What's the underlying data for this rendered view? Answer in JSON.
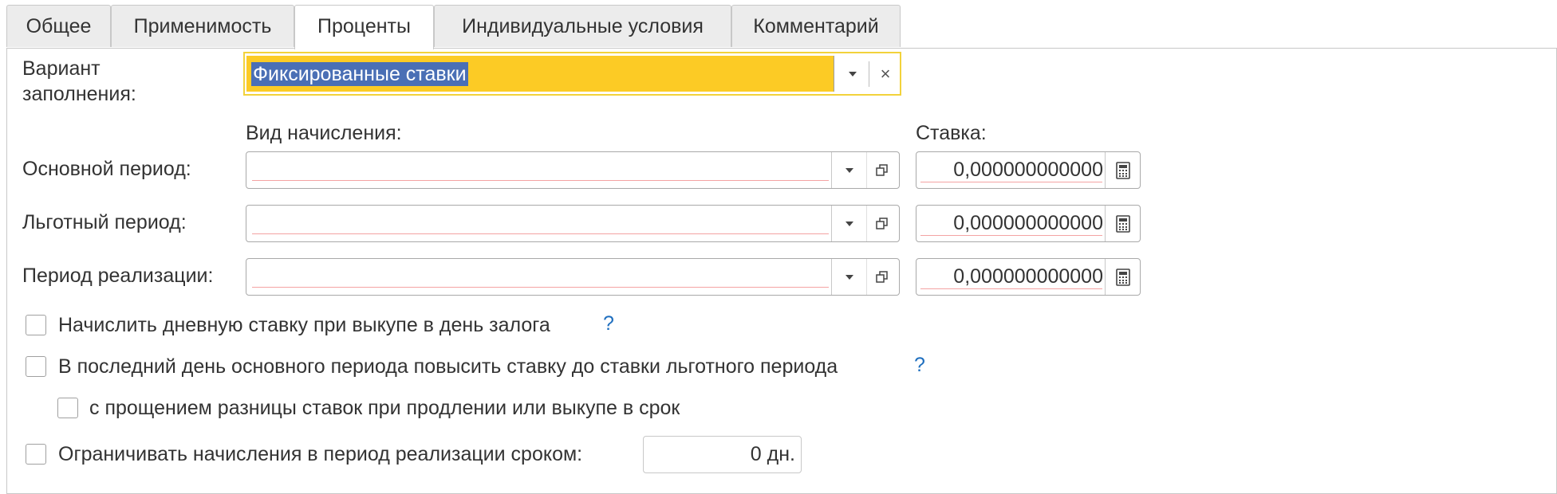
{
  "tabs": [
    {
      "label": "Общее",
      "active": false
    },
    {
      "label": "Применимость",
      "active": false
    },
    {
      "label": "Проценты",
      "active": true
    },
    {
      "label": "Индивидуальные условия",
      "active": false
    },
    {
      "label": "Комментарий",
      "active": false
    }
  ],
  "form": {
    "variant_label": "Вариант\nзаполнения:",
    "variant_value": "Фиксированные ставки",
    "clear_glyph": "×",
    "col_accrual": "Вид начисления:",
    "col_rate": "Ставка:",
    "rows": [
      {
        "label": "Основной период:",
        "accrual": "",
        "rate": "0,000000000000"
      },
      {
        "label": "Льготный период:",
        "accrual": "",
        "rate": "0,000000000000"
      },
      {
        "label": "Период реализации:",
        "accrual": "",
        "rate": "0,000000000000"
      }
    ],
    "checkboxes": [
      {
        "label": "Начислить дневную ставку при выкупе в день залога",
        "checked": false,
        "help": "?"
      },
      {
        "label": "В последний день основного периода повысить ставку до ставки льготного периода",
        "checked": false,
        "help": "?"
      },
      {
        "label": "с прощением разницы ставок при продлении или выкупе в срок",
        "checked": false
      },
      {
        "label": "Ограничивать начисления в период реализации сроком:",
        "checked": false
      }
    ],
    "limit_days": "0 дн."
  },
  "colors": {
    "variant_fill": "#fccb25",
    "variant_border": "#f2d23b",
    "selection": "#4a6fb5",
    "help": "#1f6fbf"
  }
}
